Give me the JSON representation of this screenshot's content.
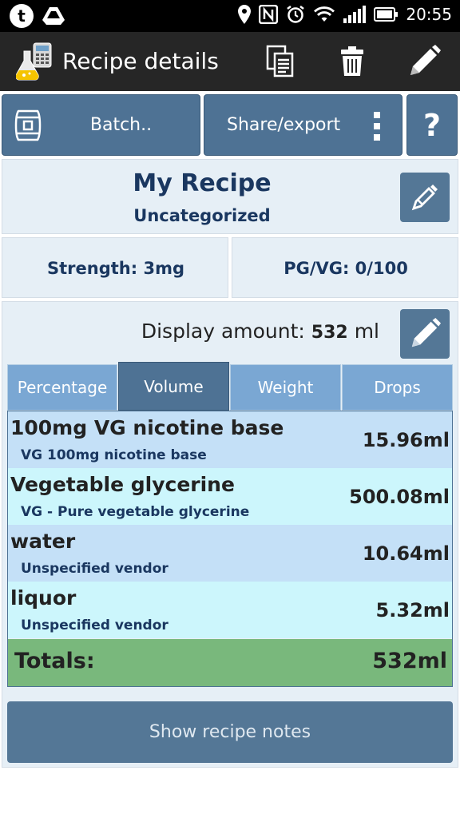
{
  "status_bar": {
    "time": "20:55",
    "icons": [
      "tumblr-notification-icon",
      "drive-icon",
      "location-icon",
      "nfc-icon",
      "alarm-icon",
      "wifi-icon",
      "signal-icon",
      "battery-icon"
    ]
  },
  "action_bar": {
    "title": "Recipe details",
    "icons": [
      "app-flask-icon",
      "copy-icon",
      "trash-icon",
      "edit-pencil-icon"
    ]
  },
  "toolbar": {
    "batch_label": "Batch..",
    "share_label": "Share/export",
    "help_label": "?"
  },
  "recipe": {
    "name": "My Recipe",
    "category": "Uncategorized",
    "strength": "Strength: 3mg",
    "pgvg": "PG/VG: 0/100"
  },
  "display": {
    "label": "Display amount:",
    "value": "532",
    "unit": "ml"
  },
  "tabs": [
    {
      "label": "Percentage",
      "active": false
    },
    {
      "label": "Volume",
      "active": true
    },
    {
      "label": "Weight",
      "active": false
    },
    {
      "label": "Drops",
      "active": false
    }
  ],
  "ingredients": [
    {
      "name": "100mg VG nicotine base",
      "vendor": "VG 100mg nicotine base",
      "volume": "15.96ml"
    },
    {
      "name": "Vegetable glycerine",
      "vendor": "VG - Pure vegetable glycerine",
      "volume": "500.08ml"
    },
    {
      "name": "water",
      "vendor": "Unspecified vendor",
      "volume": "10.64ml"
    },
    {
      "name": "liquor",
      "vendor": "Unspecified vendor",
      "volume": "5.32ml"
    }
  ],
  "totals": {
    "label": "Totals:",
    "value": "532ml"
  },
  "notes_button": "Show recipe notes",
  "colors": {
    "button_blue": "#4e7294",
    "tab_light": "#7aa7d3",
    "row_blue": "#c4e0f7",
    "row_cyan": "#ccf6fc",
    "totals_green": "#79b87c",
    "navy_text": "#1a3760"
  }
}
